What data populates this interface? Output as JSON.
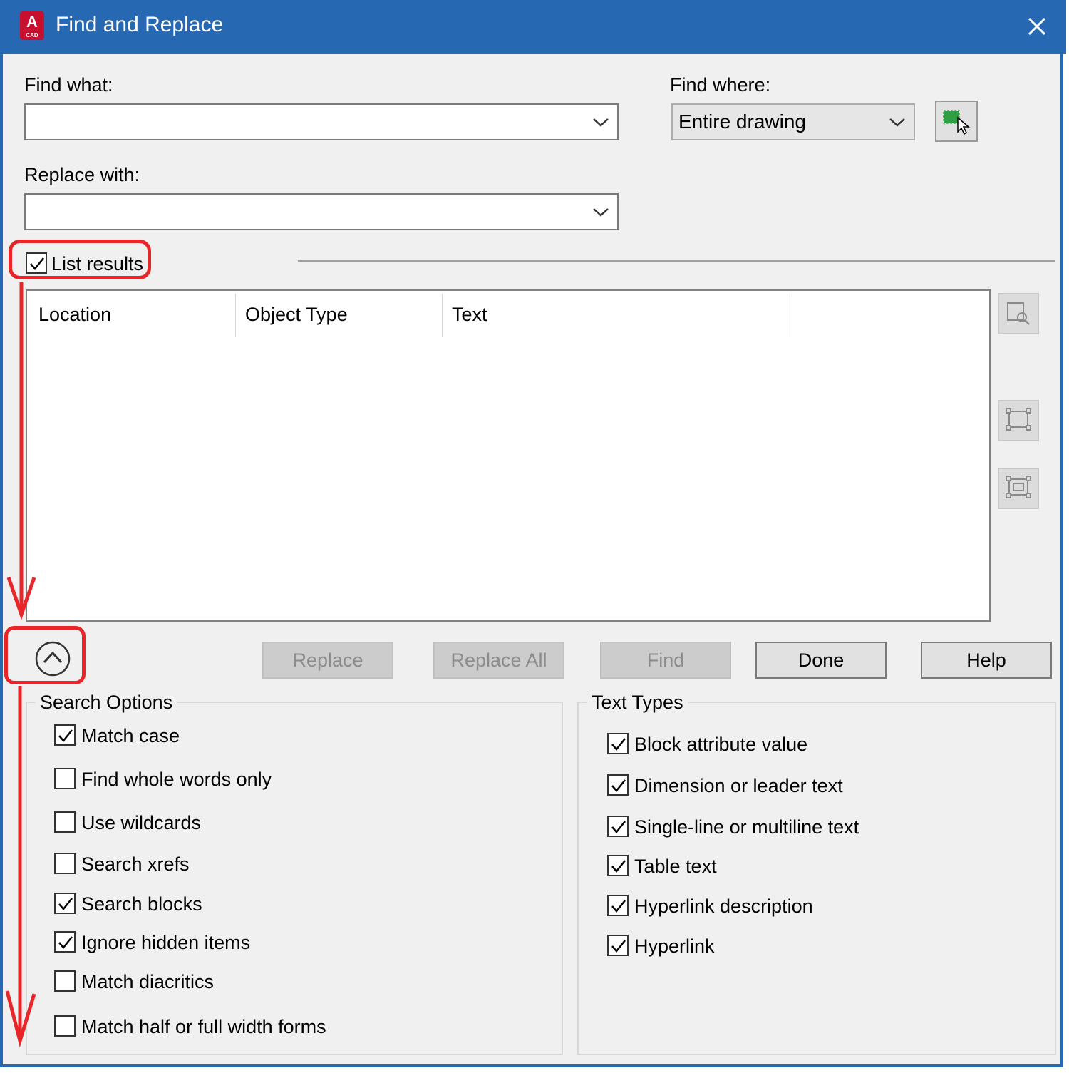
{
  "window": {
    "title": "Find and Replace",
    "app_icon_letter": "A",
    "app_icon_sub": "CAD",
    "accent_color": "#2768b2"
  },
  "find_what": {
    "label": "Find what:",
    "value": ""
  },
  "replace_with": {
    "label": "Replace with:",
    "value": ""
  },
  "find_where": {
    "label": "Find where:",
    "value": "Entire drawing"
  },
  "list_results": {
    "label": "List results",
    "checked": true
  },
  "results_table": {
    "columns": [
      "Location",
      "Object Type",
      "Text"
    ],
    "rows": []
  },
  "buttons": {
    "replace": "Replace",
    "replace_all": "Replace All",
    "find": "Find",
    "done": "Done",
    "help": "Help"
  },
  "search_options": {
    "title": "Search Options",
    "items": [
      {
        "label": "Match case",
        "checked": true
      },
      {
        "label": "Find whole words only",
        "checked": false
      },
      {
        "label": "Use wildcards",
        "checked": false
      },
      {
        "label": "Search xrefs",
        "checked": false
      },
      {
        "label": "Search blocks",
        "checked": true
      },
      {
        "label": "Ignore hidden items",
        "checked": true
      },
      {
        "label": "Match diacritics",
        "checked": false
      },
      {
        "label": "Match half or full width forms",
        "checked": false
      }
    ]
  },
  "text_types": {
    "title": "Text Types",
    "items": [
      {
        "label": "Block attribute value",
        "checked": true
      },
      {
        "label": "Dimension or leader text",
        "checked": true
      },
      {
        "label": "Single-line or multiline text",
        "checked": true
      },
      {
        "label": "Table text",
        "checked": true
      },
      {
        "label": "Hyperlink description",
        "checked": true
      },
      {
        "label": "Hyperlink",
        "checked": true
      }
    ]
  },
  "annotation_color": "#e8262a"
}
